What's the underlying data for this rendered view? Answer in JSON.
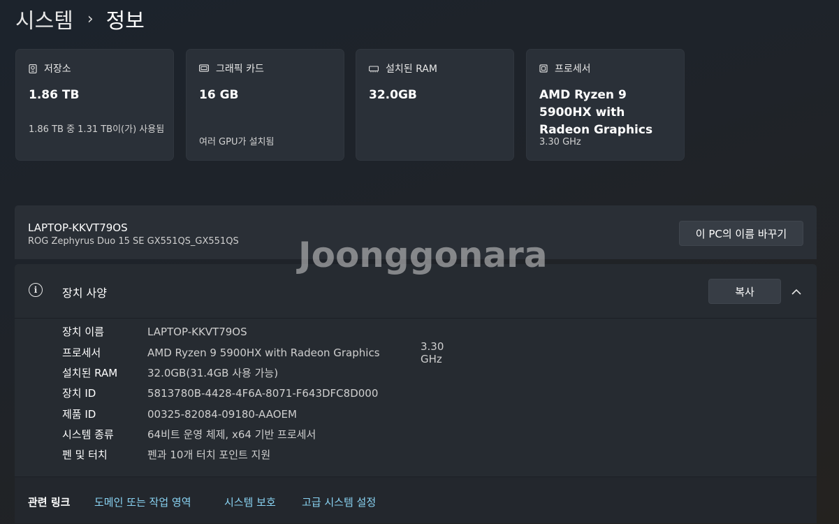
{
  "breadcrumb": {
    "parent": "시스템",
    "separator": "›",
    "current": "정보"
  },
  "cards": [
    {
      "icon": "storage-icon",
      "title": "저장소",
      "value": "1.86 TB",
      "sub": "1.86 TB 중 1.31 TB이(가) 사용됨"
    },
    {
      "icon": "gpu-icon",
      "title": "그래픽 카드",
      "value": "16 GB",
      "sub": "여러 GPU가 설치됨"
    },
    {
      "icon": "ram-icon",
      "title": "설치된 RAM",
      "value": "32.0GB",
      "sub": ""
    },
    {
      "icon": "processor-icon",
      "title": "프로세서",
      "value": "AMD Ryzen 9 5900HX with Radeon Graphics",
      "sub": "3.30 GHz"
    }
  ],
  "device": {
    "name": "LAPTOP-KKVT79OS",
    "model": "ROG Zephyrus Duo 15 SE GX551QS_GX551QS",
    "rename_label": "이 PC의 이름 바꾸기"
  },
  "specs": {
    "title": "장치 사양",
    "copy_label": "복사",
    "rows": [
      {
        "key": "장치 이름",
        "value": "LAPTOP-KKVT79OS",
        "extra": ""
      },
      {
        "key": "프로세서",
        "value": "AMD Ryzen 9 5900HX with Radeon Graphics",
        "extra": "3.30 GHz"
      },
      {
        "key": "설치된 RAM",
        "value": "32.0GB(31.4GB 사용 가능)",
        "extra": ""
      },
      {
        "key": "장치 ID",
        "value": "5813780B-4428-4F6A-8071-F643DFC8D000",
        "extra": ""
      },
      {
        "key": "제품 ID",
        "value": "00325-82084-09180-AAOEM",
        "extra": ""
      },
      {
        "key": "시스템 종류",
        "value": "64비트 운영 체제, x64 기반 프로세서",
        "extra": ""
      },
      {
        "key": "펜 및 터치",
        "value": "펜과 10개 터치 포인트 지원",
        "extra": ""
      }
    ]
  },
  "related": {
    "label": "관련 링크",
    "links": [
      "도메인 또는 작업 영역",
      "시스템 보호",
      "고급 시스템 설정"
    ]
  },
  "watermark": "Joonggonara",
  "colors": {
    "link": "#8ad4f4",
    "card_bg": "#2a3038"
  }
}
